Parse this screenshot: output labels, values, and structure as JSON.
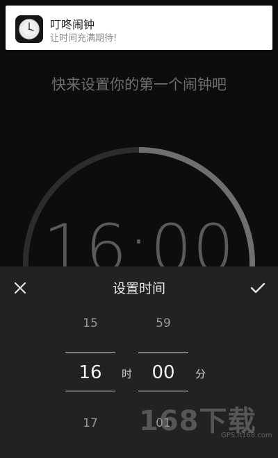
{
  "notification": {
    "icon": "clock-icon",
    "title": "叮咚闹钟",
    "subtitle": "让时间充满期待!"
  },
  "hint": "快来设置你的第一个闹钟吧",
  "dial": {
    "time": "16:00",
    "progress_fraction": 0.45,
    "colors": {
      "track": "#2c2c2c",
      "progress": "#6f6f6f"
    }
  },
  "picker": {
    "title": "设置时间",
    "close_icon": "close-icon",
    "confirm_icon": "check-icon",
    "hour": {
      "prev": "15",
      "selected": "16",
      "next": "17",
      "unit": "时"
    },
    "minute": {
      "prev": "59",
      "selected": "00",
      "next": "01",
      "unit": "分"
    }
  },
  "watermark": {
    "main": "168下载",
    "sub": "GPS.it168.com"
  }
}
